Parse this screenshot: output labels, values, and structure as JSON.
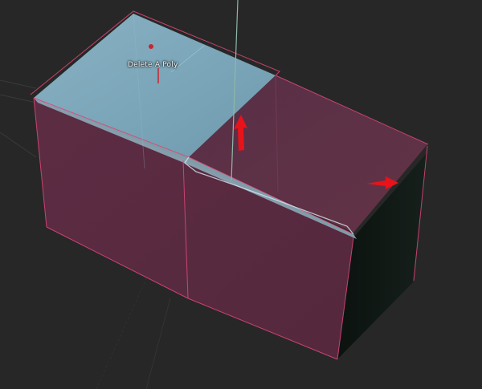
{
  "viewport": {
    "tooltip": "Delete A Poly",
    "colors": {
      "background": "#272727",
      "grid": "#3a3a3a",
      "face_front": "#5c2d43",
      "face_top_right": "#5e3046",
      "face_right": "#0f1612",
      "selected_face": "#7ca6ba",
      "wire_highlight": "#e0487a",
      "gizmo": "#e8131a",
      "gizmo_axis": "#8fb8a8"
    },
    "icons": [
      "move-y-arrow-icon",
      "move-x-arrow-icon",
      "pivot-point-icon"
    ]
  }
}
